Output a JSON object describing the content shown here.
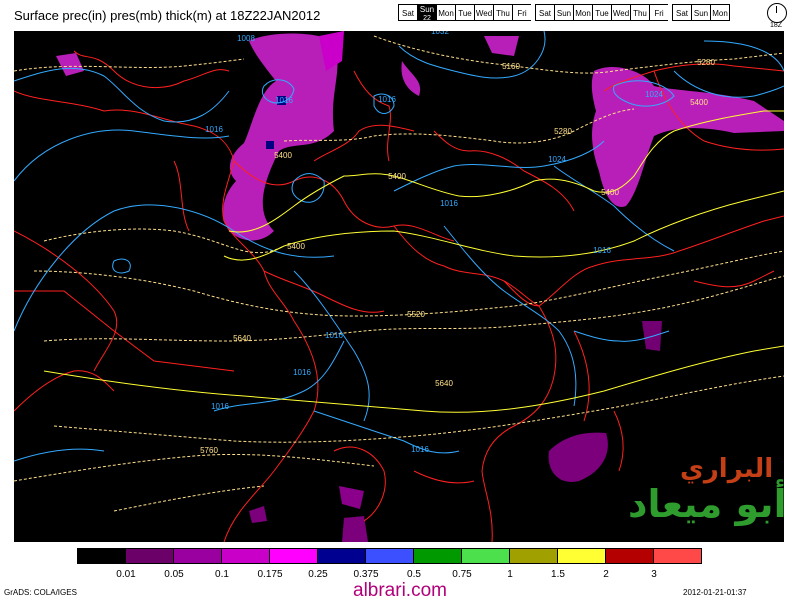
{
  "title": "Surface prec(in) pres(mb) thick(m) at 18Z22JAN2012",
  "day_strip": {
    "days": [
      "Sat",
      "Sun",
      "Mon",
      "Tue",
      "Wed",
      "Thu",
      "Fri",
      "",
      "Sat",
      "Sun",
      "Mon",
      "Tue",
      "Wed",
      "Thu",
      "Fri",
      "",
      "Sat",
      "Sun",
      "Mon"
    ],
    "active_index": 1,
    "active_sub": "22"
  },
  "clock_label": "18Z",
  "map": {
    "pressure_labels": [
      "1008",
      "1032",
      "1016",
      "1016",
      "1016",
      "1024",
      "1024",
      "1016",
      "1016",
      "1016",
      "1016",
      "1016",
      "1016"
    ],
    "thickness_labels": [
      "5160",
      "5280",
      "5400",
      "5280",
      "5400",
      "5400",
      "5400",
      "5400",
      "5520",
      "5640",
      "5640",
      "5760"
    ],
    "colors": {
      "background": "#000000",
      "coast": "#ff2020",
      "pressure": "#33aaff",
      "thickness_low": "#ffff33",
      "thickness_high": "#ffe08a",
      "precip": "#cc22cc"
    }
  },
  "legend": {
    "colors": [
      "#000000",
      "#6b0069",
      "#9a00a0",
      "#c800c8",
      "#ff00ff",
      "#000090",
      "#3c50ff",
      "#009900",
      "#4ce04c",
      "#a0a000",
      "#ffff33",
      "#b40000",
      "#ff4848"
    ],
    "labels": [
      "0.01",
      "0.05",
      "0.1",
      "0.175",
      "0.25",
      "0.375",
      "0.5",
      "0.75",
      "1",
      "1.5",
      "2",
      "3"
    ]
  },
  "watermark": {
    "line1": "البراري",
    "line2": "أبو ميعاد"
  },
  "credit_left": "GrADS: COLA/IGES",
  "credit_right": "2012-01-21-01:37",
  "site_url": "albrari.com"
}
